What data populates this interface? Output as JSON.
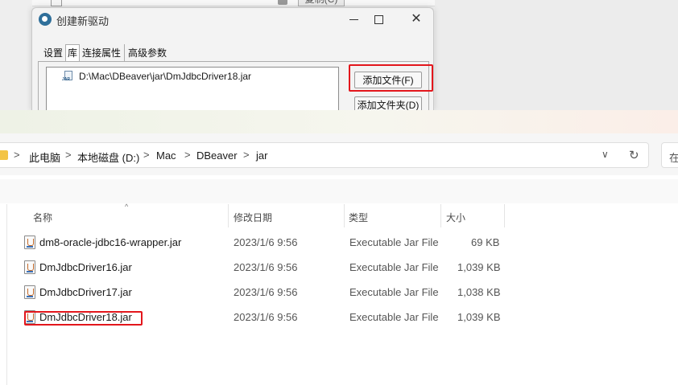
{
  "background": {
    "copy_button_label": "复制(C)"
  },
  "dialog": {
    "title": "创建新驱动",
    "close_glyph": "✕",
    "tabs": [
      {
        "label": "设置"
      },
      {
        "label": "库"
      },
      {
        "label": "连接属性"
      },
      {
        "label": "高级参数"
      }
    ],
    "active_tab": "库",
    "library_files": [
      {
        "path": "D:\\Mac\\DBeaver\\jar\\DmJdbcDriver18.jar"
      }
    ],
    "add_file_label": "添加文件(F)",
    "add_folder_label": "添加文件夹(D)",
    "highlight_color": "#e3161c"
  },
  "explorer": {
    "breadcrumb": [
      {
        "label": "此电脑"
      },
      {
        "label": "本地磁盘 (D:)"
      },
      {
        "label": "Mac"
      },
      {
        "label": "DBeaver"
      },
      {
        "label": "jar"
      }
    ],
    "separator_glyph": ">",
    "dropdown_glyph": "∨",
    "refresh_glyph": "↻",
    "search_placeholder": "在",
    "sort_glyph": "^",
    "columns": {
      "name": "名称",
      "modified": "修改日期",
      "type": "类型",
      "size": "大小"
    },
    "files": [
      {
        "name": "dm8-oracle-jdbc16-wrapper.jar",
        "modified": "2023/1/6 9:56",
        "type": "Executable Jar File",
        "size": "69 KB"
      },
      {
        "name": "DmJdbcDriver16.jar",
        "modified": "2023/1/6 9:56",
        "type": "Executable Jar File",
        "size": "1,039 KB"
      },
      {
        "name": "DmJdbcDriver17.jar",
        "modified": "2023/1/6 9:56",
        "type": "Executable Jar File",
        "size": "1,038 KB"
      },
      {
        "name": "DmJdbcDriver18.jar",
        "modified": "2023/1/6 9:56",
        "type": "Executable Jar File",
        "size": "1,039 KB"
      }
    ],
    "highlighted_file": "DmJdbcDriver18.jar"
  }
}
